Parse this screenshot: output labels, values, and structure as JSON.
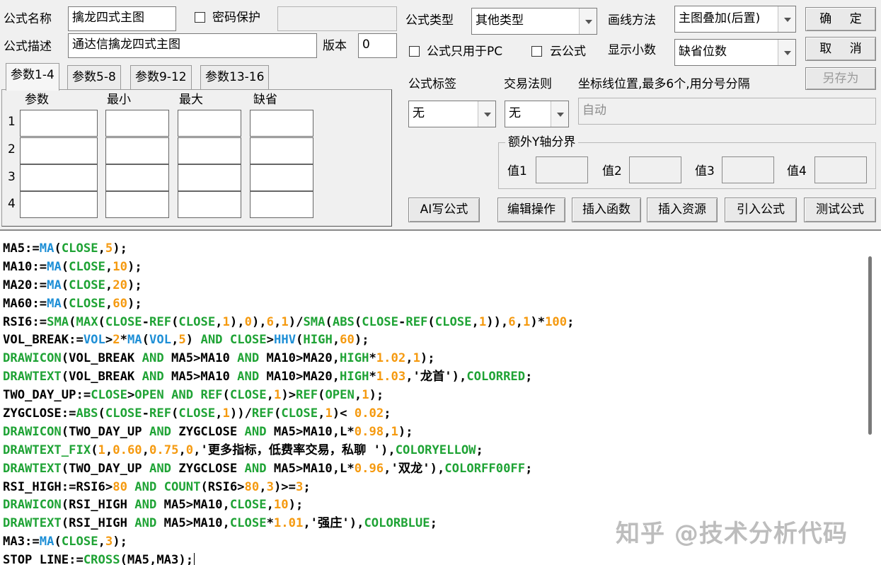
{
  "formula_name": {
    "label": "公式名称",
    "value": "擒龙四式主图"
  },
  "password": {
    "label": "密码保护",
    "checked": false,
    "value": ""
  },
  "formula_desc": {
    "label": "公式描述",
    "value": "通达信擒龙四式主图"
  },
  "version": {
    "label": "版本",
    "value": "0"
  },
  "formula_type": {
    "label": "公式类型",
    "value": "其他类型"
  },
  "draw_method": {
    "label": "画线方法",
    "value": "主图叠加(后置)"
  },
  "pc_only": {
    "label": "公式只用于PC",
    "checked": false
  },
  "cloud": {
    "label": "云公式",
    "checked": false
  },
  "decimals": {
    "label": "显示小数",
    "value": "缺省位数"
  },
  "buttons": {
    "confirm": "确 定",
    "cancel": "取 消",
    "save_as": "另存为"
  },
  "tabs": [
    "参数1-4",
    "参数5-8",
    "参数9-12",
    "参数13-16"
  ],
  "param_headers": [
    "参数",
    "最小",
    "最大",
    "缺省"
  ],
  "param_rows": [
    "1",
    "2",
    "3",
    "4"
  ],
  "formula_tag": {
    "label": "公式标签",
    "value": "无"
  },
  "trade_rule": {
    "label": "交易法则",
    "value": "无"
  },
  "coord_line": {
    "label": "坐标线位置,最多6个,用分号分隔",
    "value": "自动"
  },
  "extra_y": {
    "title": "额外Y轴分界",
    "labels": [
      "值1",
      "值2",
      "值3",
      "值4"
    ]
  },
  "action_buttons": {
    "ai": "AI写公式",
    "edit": "编辑操作",
    "insert_func": "插入函数",
    "insert_res": "插入资源",
    "import": "引入公式",
    "test": "测试公式"
  },
  "code_lines": [
    [
      [
        "MA5:=",
        "k"
      ],
      [
        "MA",
        "b"
      ],
      [
        "(",
        "k"
      ],
      [
        "CLOSE",
        "g"
      ],
      [
        ",",
        "k"
      ],
      [
        "5",
        "o"
      ],
      [
        ");",
        "k"
      ]
    ],
    [
      [
        "MA10:=",
        "k"
      ],
      [
        "MA",
        "b"
      ],
      [
        "(",
        "k"
      ],
      [
        "CLOSE",
        "g"
      ],
      [
        ",",
        "k"
      ],
      [
        "10",
        "o"
      ],
      [
        ");",
        "k"
      ]
    ],
    [
      [
        "MA20:=",
        "k"
      ],
      [
        "MA",
        "b"
      ],
      [
        "(",
        "k"
      ],
      [
        "CLOSE",
        "g"
      ],
      [
        ",",
        "k"
      ],
      [
        "20",
        "o"
      ],
      [
        ");",
        "k"
      ]
    ],
    [
      [
        "MA60:=",
        "k"
      ],
      [
        "MA",
        "b"
      ],
      [
        "(",
        "k"
      ],
      [
        "CLOSE",
        "g"
      ],
      [
        ",",
        "k"
      ],
      [
        "60",
        "o"
      ],
      [
        ");",
        "k"
      ]
    ],
    [
      [
        "RSI6:=",
        "k"
      ],
      [
        "SMA",
        "g"
      ],
      [
        "(",
        "k"
      ],
      [
        "MAX",
        "g"
      ],
      [
        "(",
        "k"
      ],
      [
        "CLOSE",
        "g"
      ],
      [
        "-",
        "k"
      ],
      [
        "REF",
        "g"
      ],
      [
        "(",
        "k"
      ],
      [
        "CLOSE",
        "g"
      ],
      [
        ",",
        "k"
      ],
      [
        "1",
        "o"
      ],
      [
        "),",
        "k"
      ],
      [
        "0",
        "o"
      ],
      [
        "),",
        "k"
      ],
      [
        "6",
        "o"
      ],
      [
        ",",
        "k"
      ],
      [
        "1",
        "o"
      ],
      [
        ")/",
        "k"
      ],
      [
        "SMA",
        "g"
      ],
      [
        "(",
        "k"
      ],
      [
        "ABS",
        "g"
      ],
      [
        "(",
        "k"
      ],
      [
        "CLOSE",
        "g"
      ],
      [
        "-",
        "k"
      ],
      [
        "REF",
        "g"
      ],
      [
        "(",
        "k"
      ],
      [
        "CLOSE",
        "g"
      ],
      [
        ",",
        "k"
      ],
      [
        "1",
        "o"
      ],
      [
        ")),",
        "k"
      ],
      [
        "6",
        "o"
      ],
      [
        ",",
        "k"
      ],
      [
        "1",
        "o"
      ],
      [
        ")*",
        "k"
      ],
      [
        "100",
        "o"
      ],
      [
        ";",
        "k"
      ]
    ],
    [
      [
        "VOL_BREAK:=",
        "k"
      ],
      [
        "VOL",
        "b"
      ],
      [
        ">",
        "k"
      ],
      [
        "2",
        "o"
      ],
      [
        "*",
        "k"
      ],
      [
        "MA",
        "b"
      ],
      [
        "(",
        "k"
      ],
      [
        "VOL",
        "b"
      ],
      [
        ",",
        "k"
      ],
      [
        "5",
        "o"
      ],
      [
        ") ",
        "k"
      ],
      [
        "AND",
        "g"
      ],
      [
        " ",
        "k"
      ],
      [
        "CLOSE",
        "g"
      ],
      [
        ">",
        "k"
      ],
      [
        "HHV",
        "b"
      ],
      [
        "(",
        "k"
      ],
      [
        "HIGH",
        "g"
      ],
      [
        ",",
        "k"
      ],
      [
        "60",
        "o"
      ],
      [
        ");",
        "k"
      ]
    ],
    [
      [
        "DRAWICON",
        "g"
      ],
      [
        "(VOL_BREAK ",
        "k"
      ],
      [
        "AND",
        "g"
      ],
      [
        " MA5>MA10 ",
        "k"
      ],
      [
        "AND",
        "g"
      ],
      [
        " MA10>MA20,",
        "k"
      ],
      [
        "HIGH",
        "g"
      ],
      [
        "*",
        "k"
      ],
      [
        "1.02",
        "o"
      ],
      [
        ",",
        "k"
      ],
      [
        "1",
        "o"
      ],
      [
        ");",
        "k"
      ]
    ],
    [
      [
        "DRAWTEXT",
        "g"
      ],
      [
        "(VOL_BREAK ",
        "k"
      ],
      [
        "AND",
        "g"
      ],
      [
        " MA5>MA10 ",
        "k"
      ],
      [
        "AND",
        "g"
      ],
      [
        " MA10>MA20,",
        "k"
      ],
      [
        "HIGH",
        "g"
      ],
      [
        "*",
        "k"
      ],
      [
        "1.03",
        "o"
      ],
      [
        ",'龙首'),",
        "k"
      ],
      [
        "COLORRED",
        "g"
      ],
      [
        ";",
        "k"
      ]
    ],
    [
      [
        "TWO_DAY_UP:=",
        "k"
      ],
      [
        "CLOSE",
        "g"
      ],
      [
        ">",
        "k"
      ],
      [
        "OPEN",
        "g"
      ],
      [
        " ",
        "k"
      ],
      [
        "AND",
        "g"
      ],
      [
        " ",
        "k"
      ],
      [
        "REF",
        "g"
      ],
      [
        "(",
        "k"
      ],
      [
        "CLOSE",
        "g"
      ],
      [
        ",",
        "k"
      ],
      [
        "1",
        "o"
      ],
      [
        ")>",
        "k"
      ],
      [
        "REF",
        "g"
      ],
      [
        "(",
        "k"
      ],
      [
        "OPEN",
        "g"
      ],
      [
        ",",
        "k"
      ],
      [
        "1",
        "o"
      ],
      [
        ");",
        "k"
      ]
    ],
    [
      [
        "ZYGCLOSE:=",
        "k"
      ],
      [
        "ABS",
        "g"
      ],
      [
        "(",
        "k"
      ],
      [
        "CLOSE",
        "g"
      ],
      [
        "-",
        "k"
      ],
      [
        "REF",
        "g"
      ],
      [
        "(",
        "k"
      ],
      [
        "CLOSE",
        "g"
      ],
      [
        ",",
        "k"
      ],
      [
        "1",
        "o"
      ],
      [
        "))/",
        "k"
      ],
      [
        "REF",
        "g"
      ],
      [
        "(",
        "k"
      ],
      [
        "CLOSE",
        "g"
      ],
      [
        ",",
        "k"
      ],
      [
        "1",
        "o"
      ],
      [
        ")< ",
        "k"
      ],
      [
        "0.02",
        "o"
      ],
      [
        ";",
        "k"
      ]
    ],
    [
      [
        "DRAWICON",
        "g"
      ],
      [
        "(TWO_DAY_UP ",
        "k"
      ],
      [
        "AND",
        "g"
      ],
      [
        " ZYGCLOSE ",
        "k"
      ],
      [
        "AND",
        "g"
      ],
      [
        " MA5>MA10,",
        "k"
      ],
      [
        "L",
        "k"
      ],
      [
        "*",
        "k"
      ],
      [
        "0.98",
        "o"
      ],
      [
        ",",
        "k"
      ],
      [
        "1",
        "o"
      ],
      [
        ");",
        "k"
      ]
    ],
    [
      [
        "DRAWTEXT_FIX",
        "g"
      ],
      [
        "(",
        "k"
      ],
      [
        "1",
        "o"
      ],
      [
        ",",
        "k"
      ],
      [
        "0.60",
        "o"
      ],
      [
        ",",
        "k"
      ],
      [
        "0.75",
        "o"
      ],
      [
        ",",
        "k"
      ],
      [
        "0",
        "o"
      ],
      [
        ",'更多指标，低费率交易，私聊 '),",
        "k"
      ],
      [
        "COLORYELLOW",
        "g"
      ],
      [
        ";",
        "k"
      ]
    ],
    [
      [
        "DRAWTEXT",
        "g"
      ],
      [
        "(TWO_DAY_UP ",
        "k"
      ],
      [
        "AND",
        "g"
      ],
      [
        " ZYGCLOSE ",
        "k"
      ],
      [
        "AND",
        "g"
      ],
      [
        " MA5>MA10,",
        "k"
      ],
      [
        "L",
        "k"
      ],
      [
        "*",
        "k"
      ],
      [
        "0.96",
        "o"
      ],
      [
        ",'双龙'),",
        "k"
      ],
      [
        "COLORFF00FF",
        "g"
      ],
      [
        ";",
        "k"
      ]
    ],
    [
      [
        "RSI_HIGH:=RSI6>",
        "k"
      ],
      [
        "80",
        "o"
      ],
      [
        " ",
        "k"
      ],
      [
        "AND",
        "g"
      ],
      [
        " ",
        "k"
      ],
      [
        "COUNT",
        "g"
      ],
      [
        "(RSI6>",
        "k"
      ],
      [
        "80",
        "o"
      ],
      [
        ",",
        "k"
      ],
      [
        "3",
        "o"
      ],
      [
        ")>=",
        "k"
      ],
      [
        "3",
        "o"
      ],
      [
        ";",
        "k"
      ]
    ],
    [
      [
        "DRAWICON",
        "g"
      ],
      [
        "(RSI_HIGH ",
        "k"
      ],
      [
        "AND",
        "g"
      ],
      [
        " MA5>MA10,",
        "k"
      ],
      [
        "CLOSE",
        "g"
      ],
      [
        ",",
        "k"
      ],
      [
        "10",
        "o"
      ],
      [
        ");",
        "k"
      ]
    ],
    [
      [
        "DRAWTEXT",
        "g"
      ],
      [
        "(RSI_HIGH ",
        "k"
      ],
      [
        "AND",
        "g"
      ],
      [
        " MA5>MA10,",
        "k"
      ],
      [
        "CLOSE",
        "g"
      ],
      [
        "*",
        "k"
      ],
      [
        "1.01",
        "o"
      ],
      [
        ",'强庄'),",
        "k"
      ],
      [
        "COLORBLUE",
        "g"
      ],
      [
        ";",
        "k"
      ]
    ],
    [
      [
        "MA3:=",
        "k"
      ],
      [
        "MA",
        "b"
      ],
      [
        "(",
        "k"
      ],
      [
        "CLOSE",
        "g"
      ],
      [
        ",",
        "k"
      ],
      [
        "3",
        "o"
      ],
      [
        ");",
        "k"
      ]
    ],
    [
      [
        "STOP_LINE:=",
        "k"
      ],
      [
        "CROSS",
        "g"
      ],
      [
        "(MA5,MA3);",
        "k"
      ]
    ]
  ],
  "watermark": "知乎 @技术分析代码",
  "colors": {
    "keyword_blue": "#1e8fd6",
    "function_green": "#1fa335",
    "number_orange": "#f59a10"
  }
}
